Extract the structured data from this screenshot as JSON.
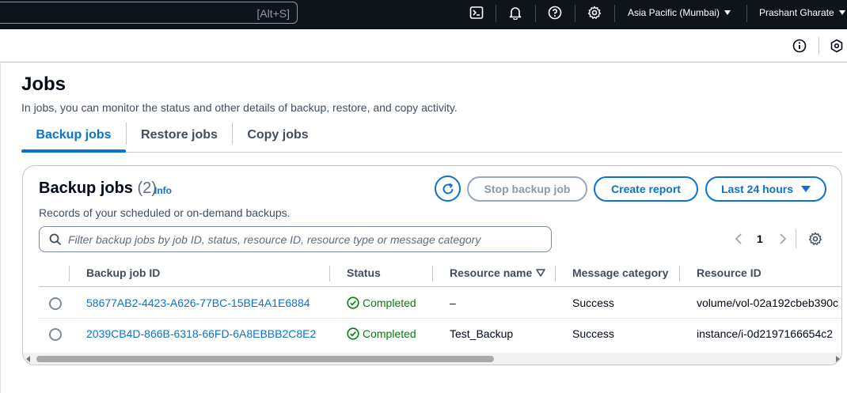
{
  "topbar": {
    "search_shortcut": "[Alt+S]",
    "icons": [
      "cloudshell-icon",
      "bell-icon",
      "help-icon",
      "gear-icon"
    ],
    "region": "Asia Pacific (Mumbai)",
    "user": "Prashant Gharate"
  },
  "page": {
    "title": "Jobs",
    "description": "In jobs, you can monitor the status and other details of backup, restore, and copy activity."
  },
  "tabs": [
    {
      "label": "Backup jobs",
      "active": true
    },
    {
      "label": "Restore jobs",
      "active": false
    },
    {
      "label": "Copy jobs",
      "active": false
    }
  ],
  "container": {
    "title": "Backup jobs",
    "count": "(2)",
    "info": "Info",
    "description": "Records of your scheduled or on-demand backups.",
    "stop_button": "Stop backup job",
    "report_button": "Create report",
    "range_button": "Last 24 hours",
    "filter_placeholder": "Filter backup jobs by job ID, status, resource ID, resource type or message category",
    "page_number": "1"
  },
  "table": {
    "columns": [
      "Backup job ID",
      "Status",
      "Resource name",
      "Message category",
      "Resource ID"
    ],
    "rows": [
      {
        "job_id": "58677AB2-4423-A626-77BC-15BE4A1E6884",
        "status": "Completed",
        "resource_name": "–",
        "message_category": "Success",
        "resource_id": "volume/vol-02a192cbeb390c"
      },
      {
        "job_id": "2039CB4D-866B-6318-66FD-6A8EBBB2C8E2",
        "status": "Completed",
        "resource_name": "Test_Backup",
        "message_category": "Success",
        "resource_id": "instance/i-0d2197166654c2"
      }
    ]
  },
  "colors": {
    "topbar_bg": "#0f141a",
    "accent": "#0972d3",
    "success": "#037f0c"
  }
}
